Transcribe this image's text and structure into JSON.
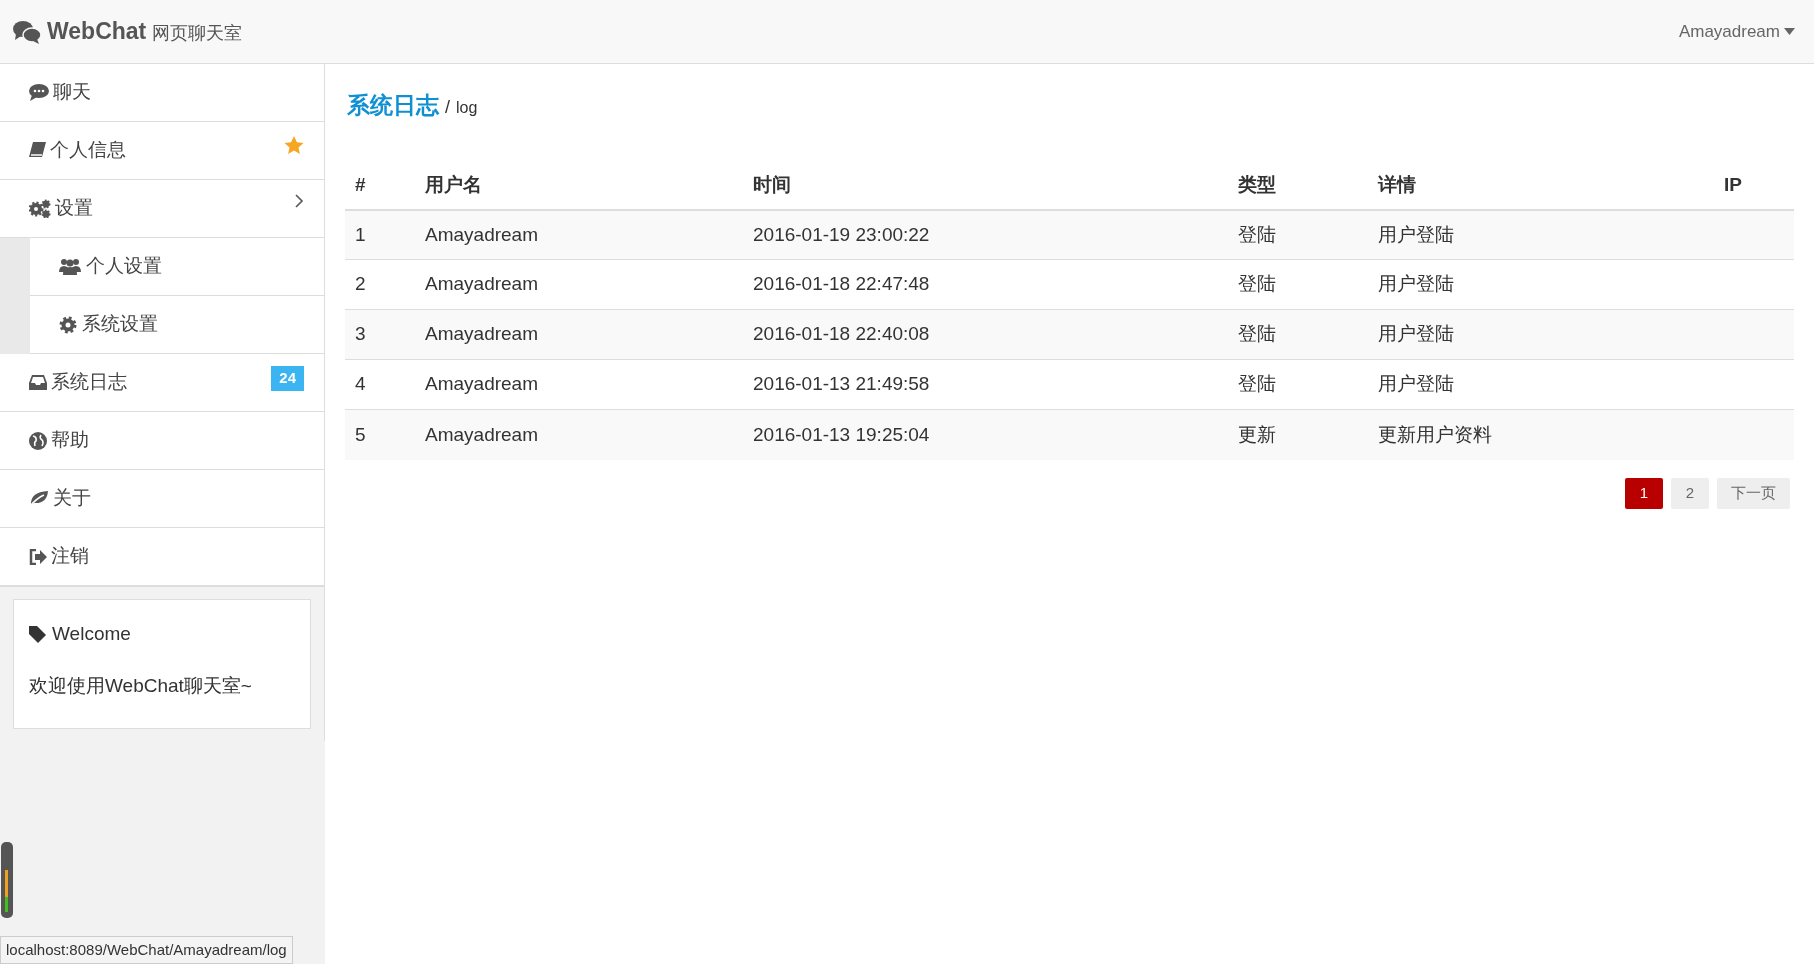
{
  "header": {
    "brand": "WebChat",
    "subtitle": "网页聊天室",
    "user_menu": "Amayadream"
  },
  "sidebar": {
    "items": [
      {
        "label": "聊天"
      },
      {
        "label": "个人信息",
        "starred": true
      },
      {
        "label": "设置",
        "children": [
          {
            "label": "个人设置"
          },
          {
            "label": "系统设置"
          }
        ]
      },
      {
        "label": "系统日志",
        "badge": "24"
      },
      {
        "label": "帮助"
      },
      {
        "label": "关于"
      },
      {
        "label": "注销"
      }
    ],
    "welcome_card": {
      "title": "Welcome",
      "text": "欢迎使用WebChat聊天室~"
    }
  },
  "page": {
    "title": "系统日志",
    "separator": "/",
    "subtitle": "log"
  },
  "table": {
    "columns": [
      "#",
      "用户名",
      "时间",
      "类型",
      "详情",
      "IP"
    ],
    "rows": [
      [
        "1",
        "Amayadream",
        "2016-01-19 23:00:22",
        "登陆",
        "用户登陆"
      ],
      [
        "2",
        "Amayadream",
        "2016-01-18 22:47:48",
        "登陆",
        "用户登陆"
      ],
      [
        "3",
        "Amayadream",
        "2016-01-18 22:40:08",
        "登陆",
        "用户登陆"
      ],
      [
        "4",
        "Amayadream",
        "2016-01-13 21:49:58",
        "登陆",
        "用户登陆"
      ],
      [
        "5",
        "Amayadream",
        "2016-01-13 19:25:04",
        "更新",
        "更新用户资料"
      ]
    ]
  },
  "pagination": [
    {
      "label": "1",
      "selected": true
    },
    {
      "label": "2",
      "selected": false
    },
    {
      "label": "下一页",
      "selected": false
    }
  ],
  "status_bar": {
    "url": "localhost:8089/WebChat/Amayadream/log"
  }
}
